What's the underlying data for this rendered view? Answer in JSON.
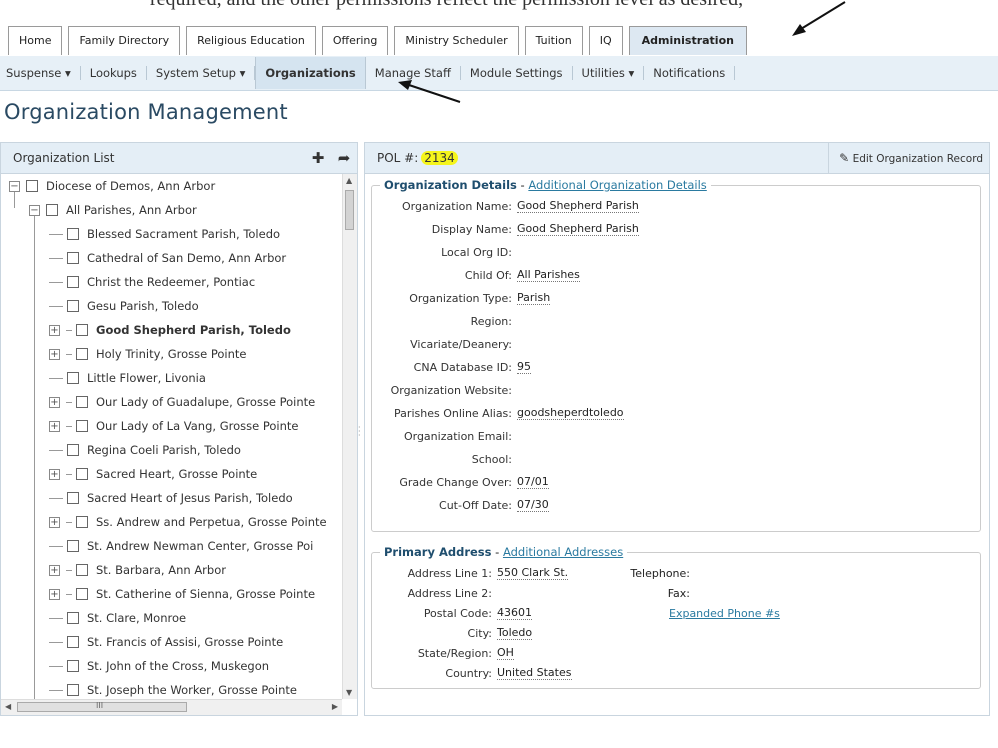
{
  "caption": "required, and the other permissions reflect the permission level as desired,",
  "tabs": [
    "Home",
    "Family Directory",
    "Religious Education",
    "Offering",
    "Ministry Scheduler",
    "Tuition",
    "IQ",
    "Administration"
  ],
  "subnav": [
    "Suspense ▾",
    "Lookups",
    "System Setup ▾",
    "Organizations",
    "Manage Staff",
    "Module Settings",
    "Utilities ▾",
    "Notifications"
  ],
  "page_title": "Organization Management",
  "left": {
    "title": "Organization List",
    "add_icon": "plus-icon",
    "share_icon": "share-arrow-icon",
    "tree": [
      {
        "label": "Diocese of Demos, Ann Arbor",
        "level": 0,
        "ctrl": "−"
      },
      {
        "label": "All Parishes, Ann Arbor",
        "level": 1,
        "ctrl": "−"
      },
      {
        "label": "Blessed Sacrament Parish, Toledo",
        "level": 2,
        "ctrl": ""
      },
      {
        "label": "Cathedral of San Demo, Ann Arbor",
        "level": 2,
        "ctrl": ""
      },
      {
        "label": "Christ the Redeemer, Pontiac",
        "level": 2,
        "ctrl": ""
      },
      {
        "label": "Gesu Parish, Toledo",
        "level": 2,
        "ctrl": ""
      },
      {
        "label": "Good Shepherd Parish, Toledo",
        "level": 2,
        "ctrl": "+",
        "bold": true
      },
      {
        "label": "Holy Trinity, Grosse Pointe",
        "level": 2,
        "ctrl": "+"
      },
      {
        "label": "Little Flower, Livonia",
        "level": 2,
        "ctrl": ""
      },
      {
        "label": "Our Lady of Guadalupe, Grosse Pointe",
        "level": 2,
        "ctrl": "+"
      },
      {
        "label": "Our Lady of La Vang, Grosse Pointe",
        "level": 2,
        "ctrl": "+"
      },
      {
        "label": "Regina Coeli Parish, Toledo",
        "level": 2,
        "ctrl": ""
      },
      {
        "label": "Sacred Heart, Grosse Pointe",
        "level": 2,
        "ctrl": "+"
      },
      {
        "label": "Sacred Heart of Jesus Parish, Toledo",
        "level": 2,
        "ctrl": ""
      },
      {
        "label": "Ss. Andrew and Perpetua, Grosse Pointe",
        "level": 2,
        "ctrl": "+"
      },
      {
        "label": "St. Andrew Newman Center, Grosse Poi",
        "level": 2,
        "ctrl": ""
      },
      {
        "label": "St. Barbara, Ann Arbor",
        "level": 2,
        "ctrl": "+"
      },
      {
        "label": "St. Catherine of Sienna, Grosse Pointe",
        "level": 2,
        "ctrl": "+"
      },
      {
        "label": "St. Clare, Monroe",
        "level": 2,
        "ctrl": ""
      },
      {
        "label": "St. Francis of Assisi, Grosse Pointe",
        "level": 2,
        "ctrl": ""
      },
      {
        "label": "St. John of the Cross, Muskegon",
        "level": 2,
        "ctrl": ""
      },
      {
        "label": "St. Joseph the Worker, Grosse Pointe",
        "level": 2,
        "ctrl": ""
      },
      {
        "label": "",
        "level": 2,
        "ctrl": ""
      }
    ],
    "hscroll_thumb": "III"
  },
  "right": {
    "pol_label": "POL #:",
    "pol_number": "2134",
    "edit_label": "Edit Organization Record",
    "details": {
      "legend": "Organization Details",
      "link": "Additional Organization Details",
      "fields": [
        {
          "label": "Organization Name:",
          "value": "Good Shepherd Parish"
        },
        {
          "label": "Display Name:",
          "value": "Good Shepherd Parish"
        },
        {
          "label": "Local Org ID:",
          "value": ""
        },
        {
          "label": "Child Of:",
          "value": "All Parishes"
        },
        {
          "label": "Organization Type:",
          "value": "Parish"
        },
        {
          "label": "Region:",
          "value": ""
        },
        {
          "label": "Vicariate/Deanery:",
          "value": ""
        },
        {
          "label": "CNA Database ID:",
          "value": "95"
        },
        {
          "label": "Organization Website:",
          "value": ""
        },
        {
          "label": "Parishes Online Alias:",
          "value": "goodsheperdtoledo"
        },
        {
          "label": "Organization Email:",
          "value": ""
        },
        {
          "label": "School:",
          "value": ""
        },
        {
          "label": "Grade Change Over:",
          "value": "07/01"
        },
        {
          "label": "Cut-Off Date:",
          "value": "07/30"
        }
      ]
    },
    "address": {
      "legend": "Primary Address",
      "link": "Additional Addresses",
      "fields": [
        {
          "label": "Address Line 1:",
          "value": "550 Clark St."
        },
        {
          "label": "Address Line 2:",
          "value": ""
        },
        {
          "label": "Postal Code:",
          "value": "43601"
        },
        {
          "label": "City:",
          "value": "Toledo"
        },
        {
          "label": "State/Region:",
          "value": "OH"
        },
        {
          "label": "Country:",
          "value": "United States"
        }
      ],
      "telephone_label": "Telephone:",
      "fax_label": "Fax:",
      "phones_link": "Expanded Phone #s"
    }
  },
  "colors": {
    "accent": "#2a4a63",
    "highlight": "#f5f51c",
    "header_bg": "#e4eef6",
    "link": "#2a7aa0"
  }
}
